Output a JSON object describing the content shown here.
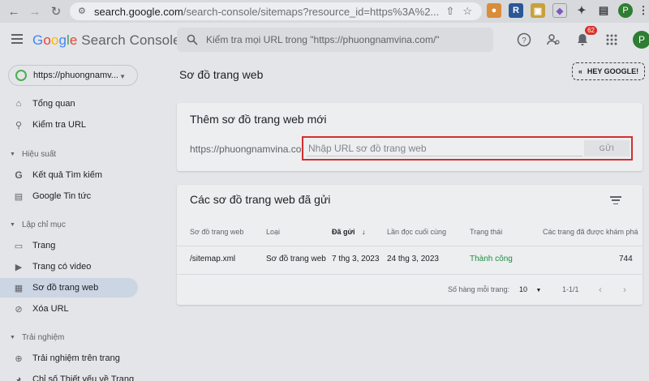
{
  "browser": {
    "url_host": "search.google.com",
    "url_path": "/search-console/sitemaps?resource_id=https%3A%2...",
    "extensions": [
      {
        "name": "r-extension-icon",
        "letter": "R",
        "color": "#2b5797"
      },
      {
        "name": "extension-icon-2",
        "letter": "▣",
        "color": "#c8a13b"
      },
      {
        "name": "shield-extension-icon",
        "letter": "◆",
        "color": "#7e57c2"
      }
    ],
    "profile_letter": "P"
  },
  "header": {
    "brand_google": [
      "G",
      "o",
      "o",
      "g",
      "l",
      "e"
    ],
    "brand_suffix": "Search Console",
    "search_placeholder": "Kiểm tra mọi URL trong \"https://phuongnamvina.com/\"",
    "notification_count": "62",
    "user_letter": "P"
  },
  "sidebar": {
    "property": "https://phuongnamv...",
    "items": [
      {
        "label": "Tổng quan",
        "icon": "home-icon"
      },
      {
        "label": "Kiểm tra URL",
        "icon": "search-icon"
      }
    ],
    "section_performance": "Hiệu suất",
    "performance_items": [
      {
        "label": "Kết quả Tìm kiếm",
        "icon": "google-g-icon"
      },
      {
        "label": "Google Tin tức",
        "icon": "news-icon"
      }
    ],
    "section_indexing": "Lập chỉ mục",
    "indexing_items": [
      {
        "label": "Trang",
        "icon": "pages-icon"
      },
      {
        "label": "Trang có video",
        "icon": "video-page-icon"
      },
      {
        "label": "Sơ đồ trang web",
        "icon": "sitemap-icon",
        "active": true
      },
      {
        "label": "Xóa URL",
        "icon": "eye-off-icon"
      }
    ],
    "section_experience": "Trải nghiệm",
    "experience_items": [
      {
        "label": "Trải nghiệm trên trang",
        "icon": "plus-circle-icon"
      },
      {
        "label": "Chỉ số Thiết yếu về Trang",
        "icon": "gauge-icon"
      }
    ]
  },
  "main": {
    "page_title": "Sơ đồ trang web",
    "hey_google": "HEY GOOGLE!",
    "add_card": {
      "title": "Thêm sơ đồ trang web mới",
      "prefix": "https://phuongnamvina.com/",
      "placeholder": "Nhập URL sơ đồ trang web",
      "submit_label": "GỬI"
    },
    "submitted_card": {
      "title": "Các sơ đồ trang web đã gửi",
      "columns": [
        "Sơ đồ trang web",
        "Loại",
        "Đã gửi",
        "Lần đọc cuối cùng",
        "Trạng thái",
        "Các trang đã được khám phá"
      ],
      "sort_arrow": "↓",
      "rows": [
        {
          "sitemap": "/sitemap.xml",
          "type": "Sơ đồ trang web",
          "submitted": "7 thg 3, 2023",
          "last_read": "24 thg 3, 2023",
          "status": "Thành công",
          "discovered": "744"
        }
      ],
      "rows_per_page_label": "Số hàng mỗi trang:",
      "rows_per_page": "10",
      "range": "1-1/1",
      "prev": "‹",
      "next": "›"
    }
  },
  "colors": {
    "success": "#1e8e3e",
    "highlight_border": "#d32f2f",
    "active_nav": "#ccd5e3"
  }
}
